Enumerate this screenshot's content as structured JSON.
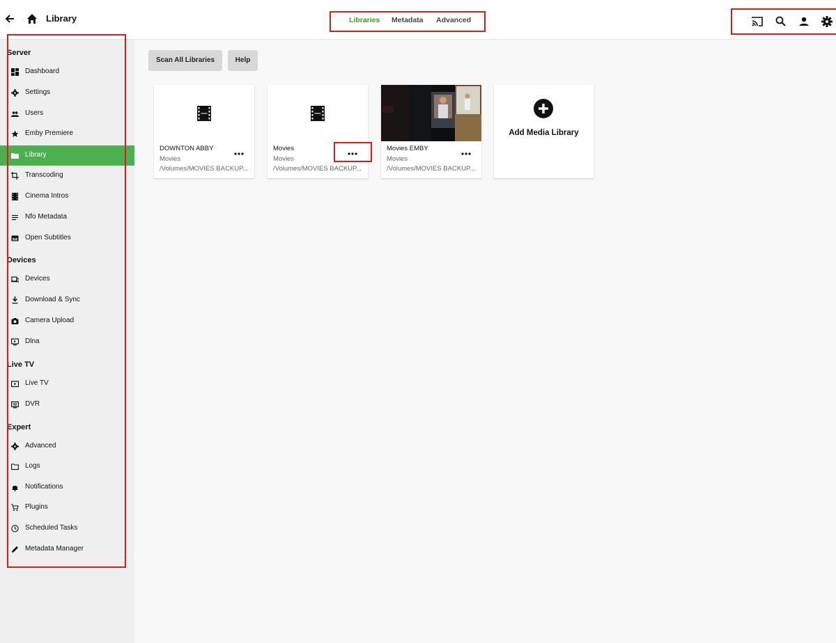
{
  "header": {
    "title": "Library",
    "tabs": [
      {
        "label": "Libraries",
        "active": true
      },
      {
        "label": "Metadata",
        "active": false
      },
      {
        "label": "Advanced",
        "active": false
      }
    ],
    "icons": [
      "cast-icon",
      "search-icon",
      "user-icon",
      "settings-icon"
    ]
  },
  "sidebar": {
    "sections": [
      {
        "title": "Server",
        "items": [
          {
            "label": "Dashboard",
            "icon": "dashboard-icon"
          },
          {
            "label": "Settings",
            "icon": "gear-icon"
          },
          {
            "label": "Users",
            "icon": "users-icon"
          },
          {
            "label": "Emby Premiere",
            "icon": "star-icon"
          },
          {
            "label": "Library",
            "icon": "folder-icon",
            "active": true
          },
          {
            "label": "Transcoding",
            "icon": "transcode-icon"
          },
          {
            "label": "Cinema Intros",
            "icon": "film-icon"
          },
          {
            "label": "Nfo Metadata",
            "icon": "notes-icon"
          },
          {
            "label": "Open Subtitles",
            "icon": "subtitles-icon"
          }
        ]
      },
      {
        "title": "Devices",
        "items": [
          {
            "label": "Devices",
            "icon": "devices-icon"
          },
          {
            "label": "Download & Sync",
            "icon": "download-icon"
          },
          {
            "label": "Camera Upload",
            "icon": "camera-icon"
          },
          {
            "label": "Dlna",
            "icon": "dlna-icon"
          }
        ]
      },
      {
        "title": "Live TV",
        "items": [
          {
            "label": "Live TV",
            "icon": "live-tv-icon"
          },
          {
            "label": "DVR",
            "icon": "dvr-icon"
          }
        ]
      },
      {
        "title": "Expert",
        "items": [
          {
            "label": "Advanced",
            "icon": "gear-icon"
          },
          {
            "label": "Logs",
            "icon": "folder-outline-icon"
          },
          {
            "label": "Notifications",
            "icon": "bell-icon"
          },
          {
            "label": "Plugins",
            "icon": "cart-icon"
          },
          {
            "label": "Scheduled Tasks",
            "icon": "clock-icon"
          },
          {
            "label": "Metadata Manager",
            "icon": "pencil-icon"
          }
        ]
      }
    ]
  },
  "toolbar": {
    "scan_label": "Scan All Libraries",
    "help_label": "Help"
  },
  "libraries": [
    {
      "name": "DOWNTON ABBY",
      "type": "Movies",
      "path": "/Volumes/MOVIES BACKUP...",
      "thumb": "film-icon"
    },
    {
      "name": "Movies",
      "type": "Movies",
      "path": "/Volumes/MOVIES BACKUP...",
      "thumb": "film-icon"
    },
    {
      "name": "Movies EMBY",
      "type": "Movies",
      "path": "/Volumes/MOVIES BACKUP...",
      "thumb": "poster-image"
    }
  ],
  "add_library": {
    "label": "Add Media Library",
    "icon": "plus-circle-icon"
  },
  "colors": {
    "accent": "#4caf50",
    "tab_active": "#3f9a1e",
    "highlight_box": "#e01a1a"
  }
}
